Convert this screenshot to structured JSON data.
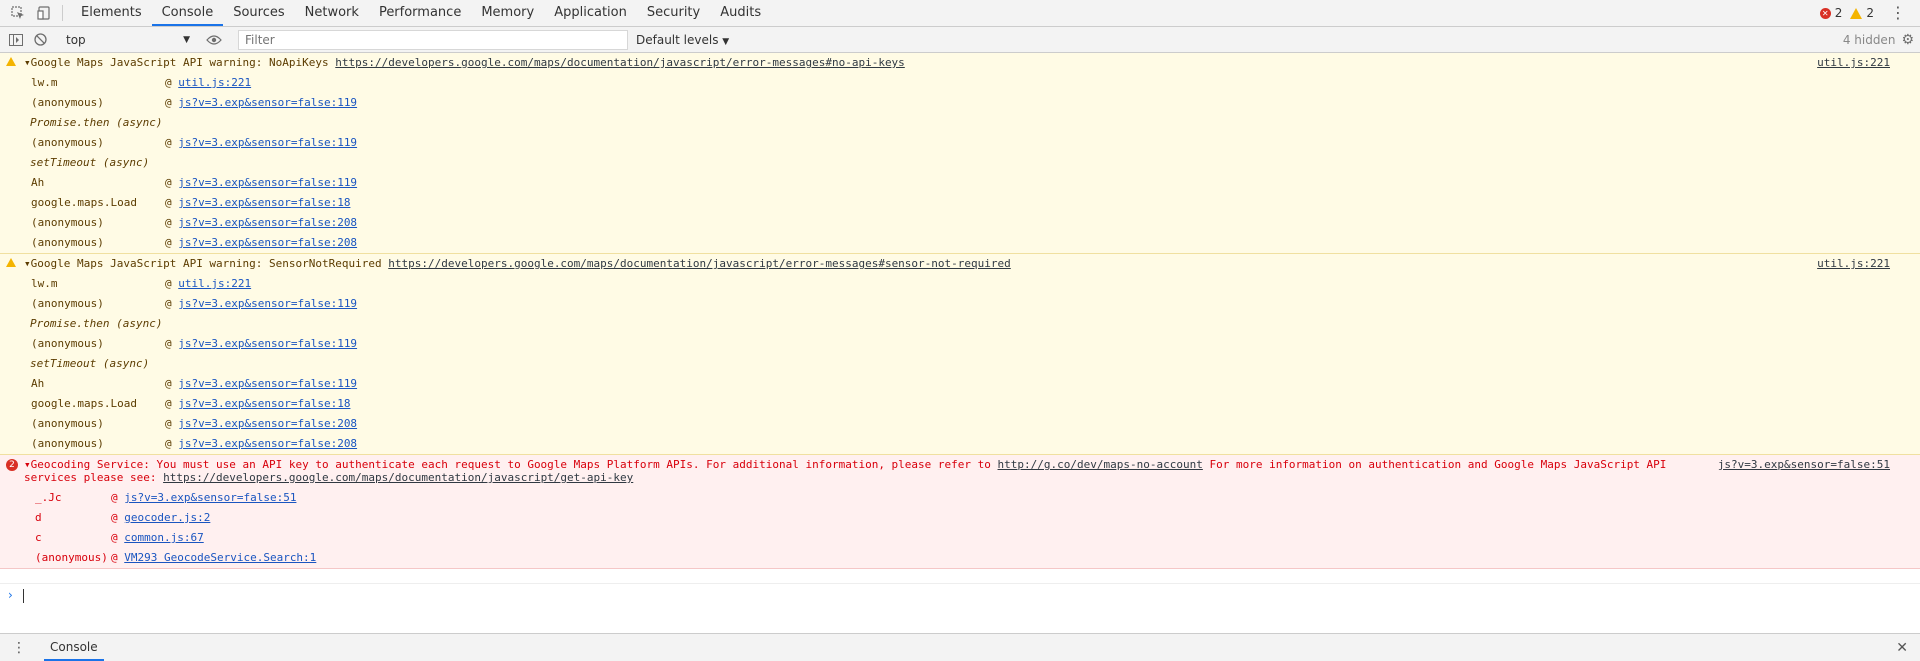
{
  "tabs": [
    "Elements",
    "Console",
    "Sources",
    "Network",
    "Performance",
    "Memory",
    "Application",
    "Security",
    "Audits"
  ],
  "active_tab": "Console",
  "counts": {
    "errors": "2",
    "warnings": "2"
  },
  "toolbar": {
    "context": "top",
    "filter_placeholder": "Filter",
    "levels": "Default levels",
    "hidden": "4 hidden"
  },
  "messages": [
    {
      "level": "warning",
      "text": "Google Maps JavaScript API warning: NoApiKeys",
      "url": "https://developers.google.com/maps/documentation/javascript/error-messages#no-api-keys",
      "source": "util.js:221",
      "stack": [
        {
          "fn": "lw.m",
          "loc": "util.js:221"
        },
        {
          "fn": "(anonymous)",
          "loc": "js?v=3.exp&sensor=false:119"
        },
        {
          "fn": "Promise.then (async)",
          "async": true
        },
        {
          "fn": "(anonymous)",
          "loc": "js?v=3.exp&sensor=false:119"
        },
        {
          "fn": "setTimeout (async)",
          "async": true
        },
        {
          "fn": "Ah",
          "loc": "js?v=3.exp&sensor=false:119"
        },
        {
          "fn": "google.maps.Load",
          "loc": "js?v=3.exp&sensor=false:18"
        },
        {
          "fn": "(anonymous)",
          "loc": "js?v=3.exp&sensor=false:208"
        },
        {
          "fn": "(anonymous)",
          "loc": "js?v=3.exp&sensor=false:208"
        }
      ]
    },
    {
      "level": "warning",
      "text": "Google Maps JavaScript API warning: SensorNotRequired",
      "url": "https://developers.google.com/maps/documentation/javascript/error-messages#sensor-not-required",
      "source": "util.js:221",
      "stack": [
        {
          "fn": "lw.m",
          "loc": "util.js:221"
        },
        {
          "fn": "(anonymous)",
          "loc": "js?v=3.exp&sensor=false:119"
        },
        {
          "fn": "Promise.then (async)",
          "async": true
        },
        {
          "fn": "(anonymous)",
          "loc": "js?v=3.exp&sensor=false:119"
        },
        {
          "fn": "setTimeout (async)",
          "async": true
        },
        {
          "fn": "Ah",
          "loc": "js?v=3.exp&sensor=false:119"
        },
        {
          "fn": "google.maps.Load",
          "loc": "js?v=3.exp&sensor=false:18"
        },
        {
          "fn": "(anonymous)",
          "loc": "js?v=3.exp&sensor=false:208"
        },
        {
          "fn": "(anonymous)",
          "loc": "js?v=3.exp&sensor=false:208"
        }
      ]
    },
    {
      "level": "error",
      "repeat": "2",
      "text": "Geocoding Service: You must use an API key to authenticate each request to Google Maps Platform APIs. For additional information, please refer to",
      "url1": "http://g.co/dev/maps-no-account",
      "text2": "For more information on authentication and Google Maps JavaScript API",
      "text3": "services please see:",
      "url2": "https://developers.google.com/maps/documentation/javascript/get-api-key",
      "source": "js?v=3.exp&sensor=false:51",
      "stack": [
        {
          "fn": "_.Jc",
          "loc": "js?v=3.exp&sensor=false:51"
        },
        {
          "fn": "d",
          "loc": "geocoder.js:2"
        },
        {
          "fn": "c",
          "loc": "common.js:67"
        },
        {
          "fn": "(anonymous)",
          "loc": "VM293 GeocodeService.Search:1"
        }
      ]
    }
  ],
  "drawer": {
    "tab": "Console"
  }
}
